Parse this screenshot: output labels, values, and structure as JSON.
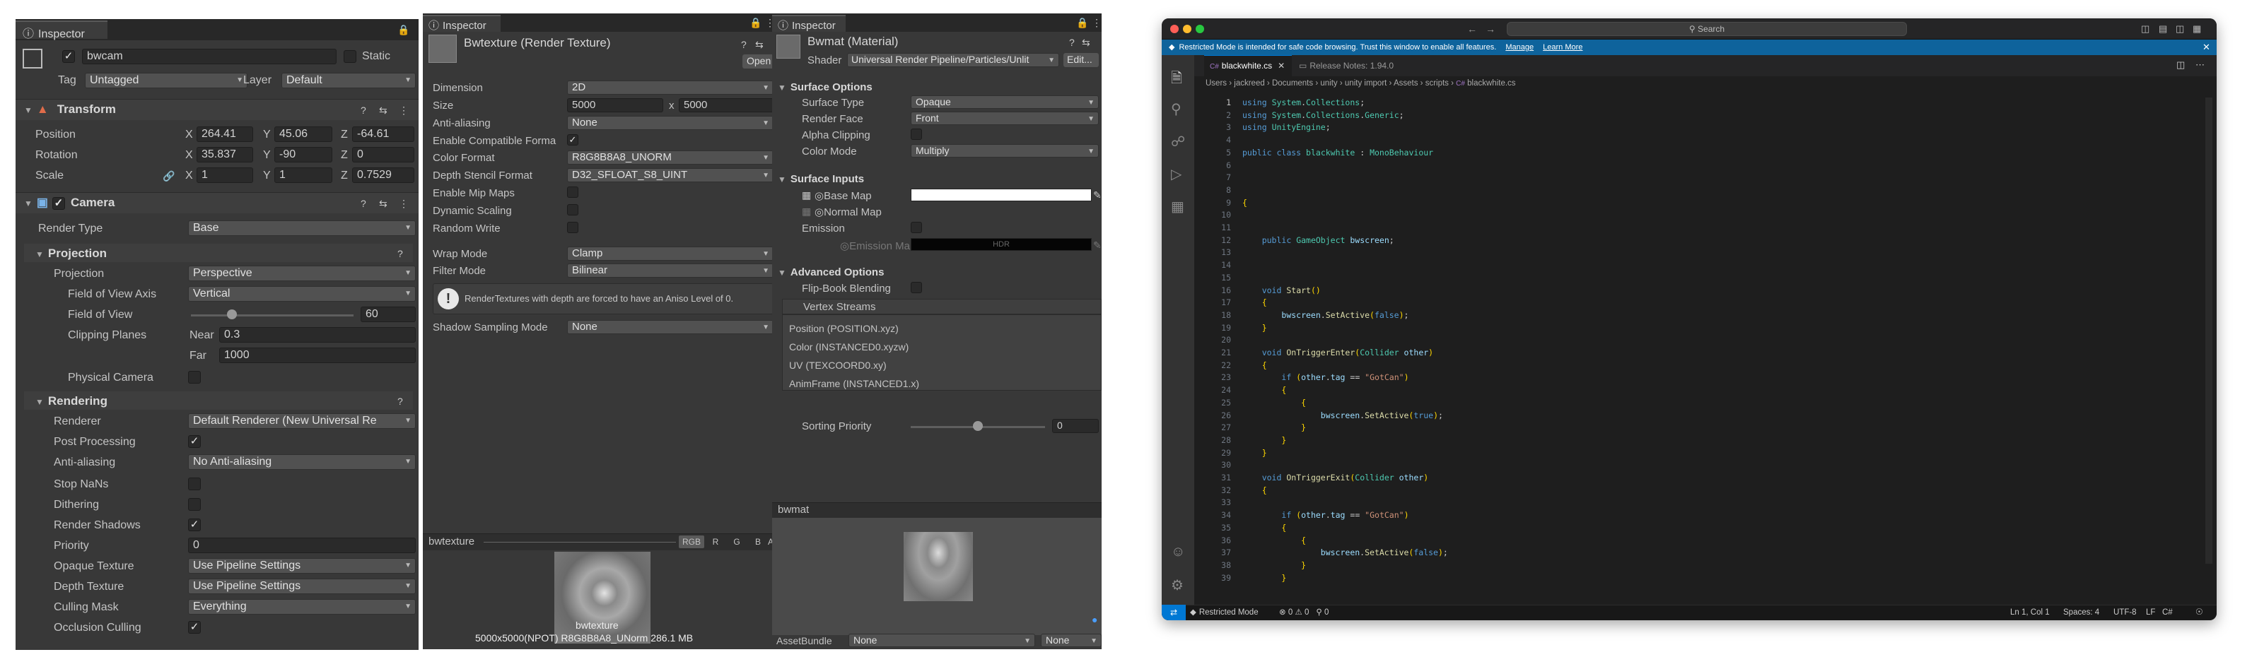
{
  "camera_inspector": {
    "tab_title": "Inspector",
    "object_name": "bwcam",
    "static_label": "Static",
    "tag_label": "Tag",
    "tag_value": "Untagged",
    "layer_label": "Layer",
    "layer_value": "Default",
    "transform": {
      "title": "Transform",
      "position_label": "Position",
      "position": {
        "x": "264.41",
        "y": "45.06",
        "z": "-64.61"
      },
      "rotation_label": "Rotation",
      "rotation": {
        "x": "35.837",
        "y": "-90",
        "z": "0"
      },
      "scale_label": "Scale",
      "scale": {
        "x": "1",
        "y": "1",
        "z": "0.7529"
      },
      "x_label": "X",
      "y_label": "Y",
      "z_label": "Z"
    },
    "camera": {
      "title": "Camera",
      "render_type_label": "Render Type",
      "render_type": "Base",
      "projection_section": "Projection",
      "projection_label": "Projection",
      "projection": "Perspective",
      "fov_axis_label": "Field of View Axis",
      "fov_axis": "Vertical",
      "fov_label": "Field of View",
      "fov": "60",
      "fov_fraction": 0.25,
      "clipping_label": "Clipping Planes",
      "near_label": "Near",
      "near": "0.3",
      "far_label": "Far",
      "far": "1000",
      "physical_label": "Physical Camera",
      "rendering_section": "Rendering",
      "renderer_label": "Renderer",
      "renderer": "Default Renderer (New Universal Re",
      "post_label": "Post Processing",
      "aa_label": "Anti-aliasing",
      "aa": "No Anti-aliasing",
      "nans_label": "Stop NaNs",
      "dither_label": "Dithering",
      "shadows_label": "Render Shadows",
      "priority_label": "Priority",
      "priority": "0",
      "opaque_label": "Opaque Texture",
      "opaque": "Use Pipeline Settings",
      "depth_label": "Depth Texture",
      "depth": "Use Pipeline Settings",
      "culling_label": "Culling Mask",
      "culling": "Everything",
      "occlusion_label": "Occlusion Culling"
    }
  },
  "texture_inspector": {
    "tab_title": "Inspector",
    "asset_title": "Bwtexture (Render Texture)",
    "open_button": "Open",
    "dimension_label": "Dimension",
    "dimension": "2D",
    "size_label": "Size",
    "size_w": "5000",
    "size_x": "x",
    "size_h": "5000",
    "aa_label": "Anti-aliasing",
    "aa": "None",
    "compat_label": "Enable Compatible Forma",
    "color_format_label": "Color Format",
    "color_format": "R8G8B8A8_UNORM",
    "depth_format_label": "Depth Stencil Format",
    "depth_format": "D32_SFLOAT_S8_UINT",
    "mip_label": "Enable Mip Maps",
    "dyn_label": "Dynamic Scaling",
    "random_label": "Random Write",
    "wrap_label": "Wrap Mode",
    "wrap": "Clamp",
    "filter_label": "Filter Mode",
    "filter": "Bilinear",
    "info_text": "RenderTextures with depth are forced to have an Aniso Level of 0.",
    "shadow_label": "Shadow Sampling Mode",
    "shadow": "None",
    "preview_title": "bwtexture",
    "channels": [
      "RGB",
      "R",
      "G",
      "B",
      "A"
    ],
    "preview_name": "bwtexture",
    "preview_info": "5000x5000(NPOT)  R8G8B8A8_UNorm  286.1 MB"
  },
  "material_inspector": {
    "tab_title": "Inspector",
    "asset_title": "Bwmat (Material)",
    "shader_label": "Shader",
    "shader": "Universal Render Pipeline/Particles/Unlit",
    "edit_button": "Edit...",
    "surface_options": "Surface Options",
    "surface_type_label": "Surface Type",
    "surface_type": "Opaque",
    "render_face_label": "Render Face",
    "render_face": "Front",
    "alpha_label": "Alpha Clipping",
    "color_mode_label": "Color Mode",
    "color_mode": "Multiply",
    "surface_inputs": "Surface Inputs",
    "base_map_label": "Base Map",
    "normal_map_label": "Normal Map",
    "emission_label": "Emission",
    "emission_map_label": "Emission Ma",
    "hdr_label": "HDR",
    "advanced_options": "Advanced Options",
    "flipbook_label": "Flip-Book Blending",
    "vertex_streams": "Vertex Streams",
    "streams": [
      "Position (POSITION.xyz)",
      "Color (INSTANCED0.xyzw)",
      "UV (TEXCOORD0.xy)",
      "AnimFrame (INSTANCED1.x)"
    ],
    "sorting_label": "Sorting Priority",
    "sorting": "0",
    "sorting_fraction": 0.5,
    "preview_title": "bwmat",
    "asset_bundle_label": "AssetBundle",
    "asset_bundle": "None",
    "asset_variant": "None"
  },
  "vscode": {
    "search_placeholder": "Search",
    "restricted_banner": "Restricted Mode is intended for safe code browsing. Trust this window to enable all features.",
    "manage_link": "Manage",
    "learn_link": "Learn More",
    "tabs": [
      {
        "label": "blackwhite.cs"
      },
      {
        "label": "Release Notes: 1.94.0"
      }
    ],
    "breadcrumbs": [
      "Users",
      "jackreed",
      "Documents",
      "unity",
      "unity import",
      "Assets",
      "scripts",
      "C#",
      "blackwhite.cs"
    ],
    "code": [
      "using System.Collections;",
      "using System.Collections.Generic;",
      "using UnityEngine;",
      "",
      "public class blackwhite : MonoBehaviour",
      "",
      "",
      "",
      "{",
      "",
      "",
      "    public GameObject bwscreen;",
      "",
      "",
      "",
      "    void Start()",
      "    {",
      "        bwscreen.SetActive(false);",
      "    }",
      "",
      "    void OnTriggerEnter(Collider other)",
      "    {",
      "        if (other.tag == \"GotCan\")",
      "        {",
      "            {",
      "                bwscreen.SetActive(true);",
      "            }",
      "        }",
      "    }",
      "",
      "    void OnTriggerExit(Collider other)",
      "    {",
      "",
      "        if (other.tag == \"GotCan\")",
      "        {",
      "            {",
      "                bwscreen.SetActive(false);",
      "            }",
      "        }",
      "    }",
      "",
      "}"
    ],
    "line_numbers": [
      "1",
      "2",
      "3",
      "4",
      "5",
      "6",
      "7",
      "8",
      "9",
      "10",
      "11",
      "12",
      "13",
      "14",
      "15",
      "16",
      "17",
      "18",
      "19",
      "20",
      "21",
      "22",
      "23",
      "24",
      "25",
      "26",
      "27",
      "28",
      "29",
      "30",
      "31",
      "32",
      "33",
      "34",
      "35",
      "36",
      "37",
      "38",
      "39"
    ],
    "status": {
      "restricted": "Restricted Mode",
      "errors": "0",
      "warnings": "0",
      "ports": "0",
      "position": "Ln 1, Col 1",
      "spaces": "Spaces: 4",
      "encoding": "UTF-8",
      "eol": "LF",
      "language": "C#"
    },
    "colors": {
      "statusbar": "#007acc",
      "editor_bg": "#1e1e1e",
      "accent": "#0078d4"
    }
  }
}
